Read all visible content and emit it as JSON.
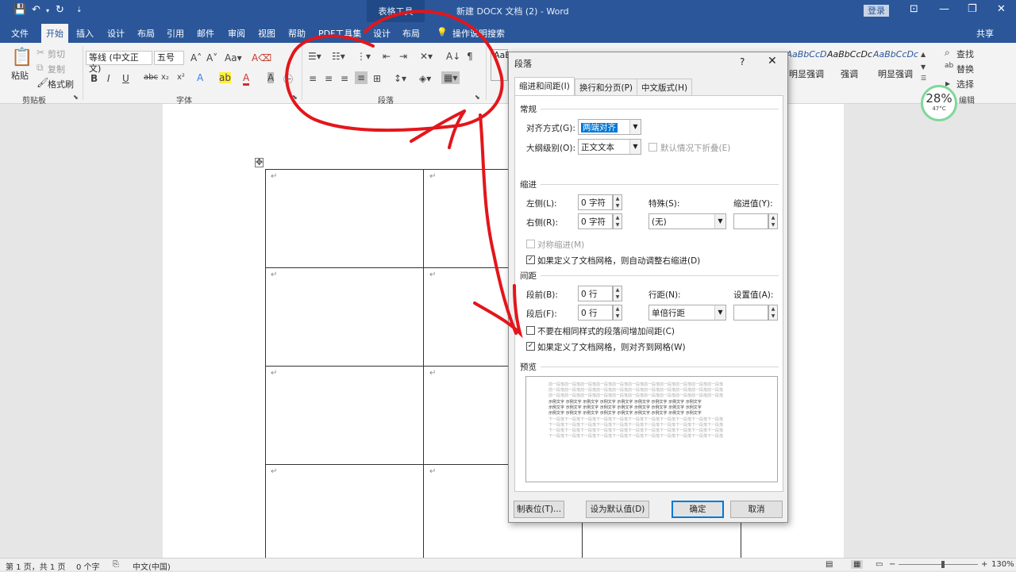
{
  "titlebar": {
    "context_tab": "表格工具",
    "doc_title": "新建 DOCX 文档 (2) - Word",
    "login": "登录"
  },
  "tabs": [
    "文件",
    "开始",
    "插入",
    "设计",
    "布局",
    "引用",
    "邮件",
    "审阅",
    "视图",
    "帮助",
    "PDF工具集",
    "设计",
    "布局"
  ],
  "tell_me": "操作说明搜索",
  "share": "共享",
  "ribbon": {
    "clipboard": {
      "paste": "粘贴",
      "cut": "剪切",
      "copy": "复制",
      "format_painter": "格式刷",
      "label": "剪贴板"
    },
    "font": {
      "family": "等线 (中文正文)",
      "size": "五号",
      "label": "字体"
    },
    "paragraph": {
      "label": "段落"
    },
    "styles": {
      "items": [
        "AaBbCcD",
        "AaBbCcDc",
        "AaBbCcDc"
      ],
      "names": [
        "明显强调",
        "强调",
        "明显强调"
      ],
      "partial_first": "AaB"
    },
    "editing": {
      "find": "查找",
      "replace": "替换",
      "select": "选择",
      "edit": "编辑"
    }
  },
  "temp_widget": {
    "percent": "28%",
    "temp": "47°C"
  },
  "dialog": {
    "title": "段落",
    "help": "?",
    "tabs": [
      "缩进和间距(I)",
      "换行和分页(P)",
      "中文版式(H)"
    ],
    "general": {
      "section": "常规",
      "align_label": "对齐方式(G):",
      "align_value": "两端对齐",
      "outline_label": "大纲级别(O):",
      "outline_value": "正文文本",
      "collapse_label": "默认情况下折叠(E)"
    },
    "indent": {
      "section": "缩进",
      "left_label": "左侧(L):",
      "left_value": "0 字符",
      "right_label": "右侧(R):",
      "right_value": "0 字符",
      "special_label": "特殊(S):",
      "special_value": "(无)",
      "by_label": "缩进值(Y):",
      "mirror_label": "对称缩进(M)",
      "auto_right_label": "如果定义了文档网格，则自动调整右缩进(D)"
    },
    "spacing": {
      "section": "间距",
      "before_label": "段前(B):",
      "before_value": "0 行",
      "after_label": "段后(F):",
      "after_value": "0 行",
      "line_label": "行距(N):",
      "line_value": "单倍行距",
      "at_label": "设置值(A):",
      "no_space_label": "不要在相同样式的段落间增加间距(C)",
      "snap_grid_label": "如果定义了文档网格，则对齐到网格(W)"
    },
    "preview": {
      "section": "预览",
      "prev_line": "前一段落前一段落前一段落前一段落前一段落前一段落前一段落前一段落前一段落前一段落前一段落",
      "sample_line": "示例文字 示例文字 示例文字 示例文字 示例文字 示例文字 示例文字 示例文字 示例文字",
      "next_line": "下一段落下一段落下一段落下一段落下一段落下一段落下一段落下一段落下一段落下一段落下一段落"
    },
    "buttons": {
      "tabs": "制表位(T)...",
      "default": "设为默认值(D)",
      "ok": "确定",
      "cancel": "取消"
    }
  },
  "statusbar": {
    "page": "第 1 页，共 1 页",
    "words": "0 个字",
    "lang": "中文(中国)",
    "zoom": "130%"
  },
  "colors": {
    "ribbon_blue": "#2b579a",
    "accent": "#0078d7",
    "annotation_red": "#e3161b"
  }
}
